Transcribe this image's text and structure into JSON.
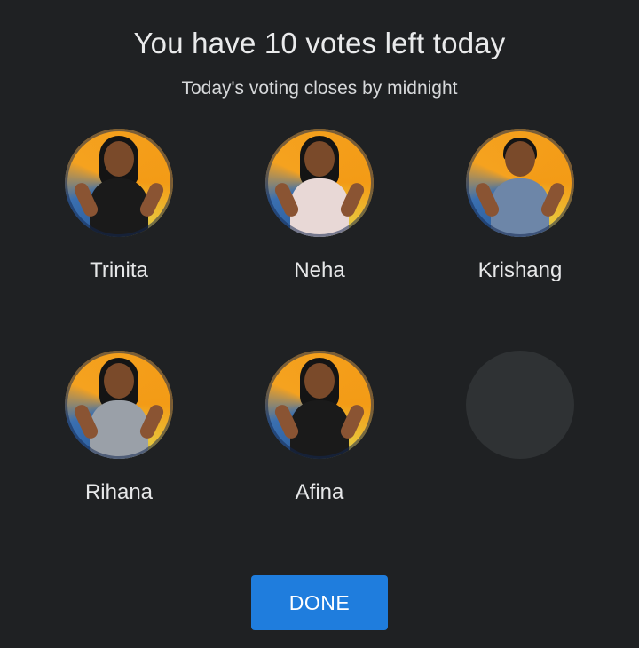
{
  "header": {
    "title": "You have 10 votes left today",
    "subtitle": "Today's voting closes by midnight"
  },
  "contestants": [
    {
      "name": "Trinita",
      "avatar_icon": "contestant-photo"
    },
    {
      "name": "Neha",
      "avatar_icon": "contestant-photo"
    },
    {
      "name": "Krishang",
      "avatar_icon": "contestant-photo"
    },
    {
      "name": "Rihana",
      "avatar_icon": "contestant-photo"
    },
    {
      "name": "Afina",
      "avatar_icon": "contestant-photo"
    }
  ],
  "footer": {
    "done_label": "DONE"
  },
  "colors": {
    "background": "#1f2123",
    "accent": "#1f7ddd",
    "placeholder": "#2f3234"
  }
}
